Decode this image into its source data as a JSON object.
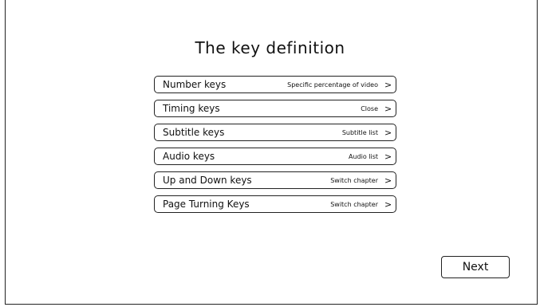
{
  "page": {
    "title": "The key definition"
  },
  "keys": [
    {
      "label": "Number keys",
      "value": "Specific percentage of video",
      "icon": "chevron-right-icon"
    },
    {
      "label": "Timing keys",
      "value": "Close",
      "icon": "chevron-right-icon"
    },
    {
      "label": "Subtitle keys",
      "value": "Subtitle list",
      "icon": "chevron-right-icon"
    },
    {
      "label": "Audio keys",
      "value": "Audio list",
      "icon": "chevron-right-icon"
    },
    {
      "label": "Up and Down keys",
      "value": "Switch chapter",
      "icon": "chevron-right-icon"
    },
    {
      "label": "Page Turning Keys",
      "value": "Switch chapter",
      "icon": "chevron-right-icon"
    }
  ],
  "chevron_glyph": ">",
  "footer": {
    "next_label": "Next"
  }
}
